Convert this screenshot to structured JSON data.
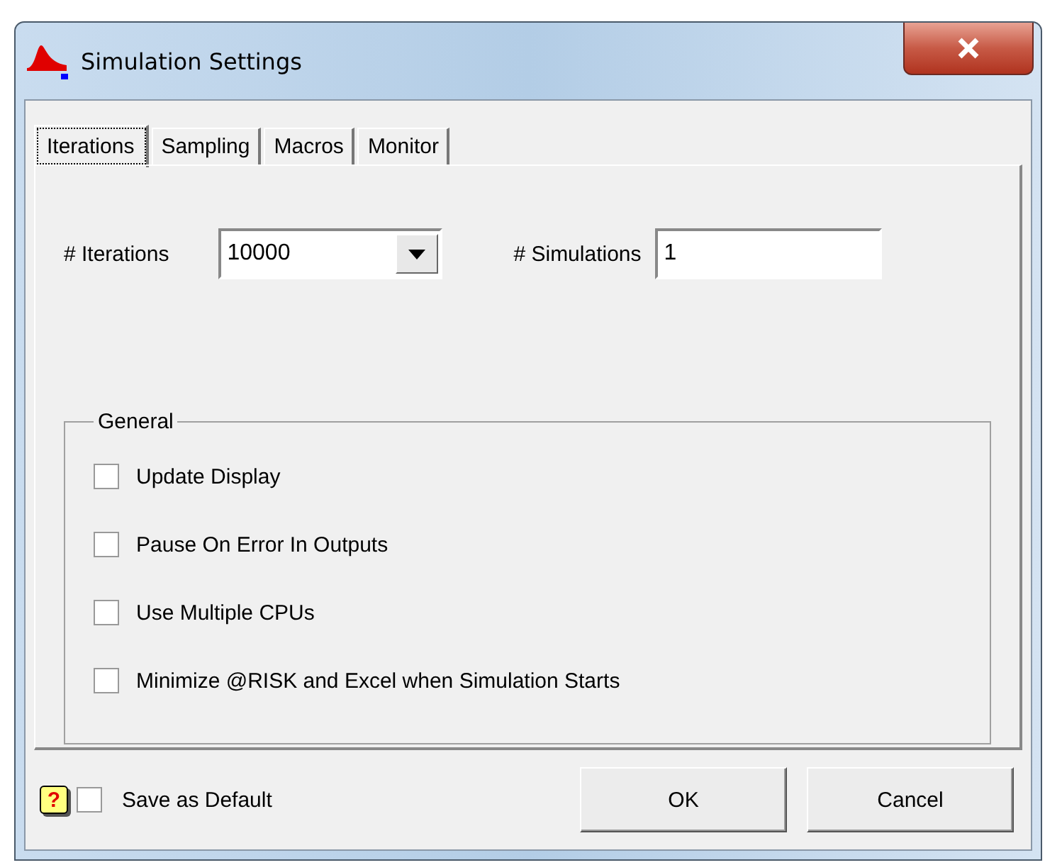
{
  "window": {
    "title": "Simulation Settings"
  },
  "tabs": [
    {
      "label": "Iterations",
      "selected": true
    },
    {
      "label": "Sampling",
      "selected": false
    },
    {
      "label": "Macros",
      "selected": false
    },
    {
      "label": "Monitor",
      "selected": false
    }
  ],
  "iterations": {
    "label": "# Iterations",
    "value": "10000"
  },
  "simulations": {
    "label": "# Simulations",
    "value": "1"
  },
  "general": {
    "title": "General",
    "options": [
      {
        "label": "Update Display",
        "checked": false
      },
      {
        "label": "Pause On Error In Outputs",
        "checked": false
      },
      {
        "label": "Use Multiple CPUs",
        "checked": false
      },
      {
        "label": "Minimize @RISK and Excel when Simulation Starts",
        "checked": false
      }
    ]
  },
  "footer": {
    "help": "?",
    "save_default": {
      "label": "Save as Default",
      "checked": false
    },
    "buttons": [
      "OK",
      "Cancel"
    ]
  }
}
